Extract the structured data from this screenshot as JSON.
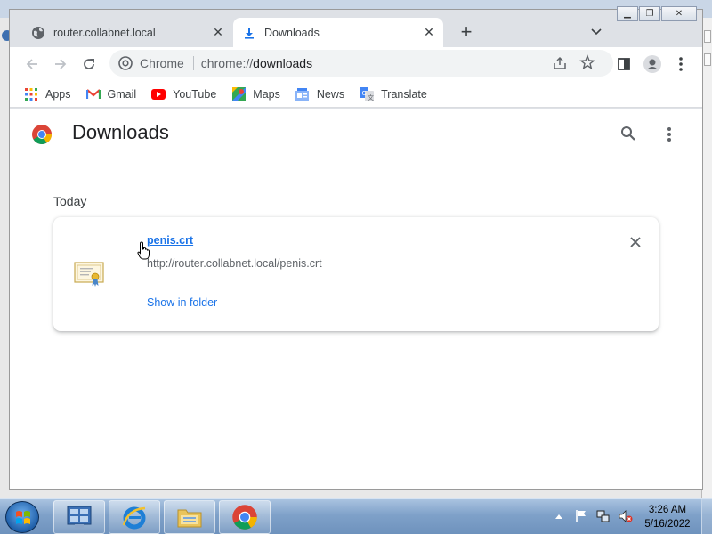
{
  "tabs": [
    {
      "title": "router.collabnet.local",
      "favicon": "globe-icon",
      "active": false
    },
    {
      "title": "Downloads",
      "favicon": "download-icon",
      "active": true
    }
  ],
  "omnibox": {
    "chip": "Chrome",
    "scheme": "chrome://",
    "host": "downloads"
  },
  "bookmarks": [
    {
      "label": "Apps",
      "icon": "apps-grid-icon"
    },
    {
      "label": "Gmail",
      "icon": "gmail-icon"
    },
    {
      "label": "YouTube",
      "icon": "youtube-icon"
    },
    {
      "label": "Maps",
      "icon": "maps-icon"
    },
    {
      "label": "News",
      "icon": "news-icon"
    },
    {
      "label": "Translate",
      "icon": "translate-icon"
    }
  ],
  "downloads_page": {
    "title": "Downloads",
    "date_label": "Today",
    "item": {
      "filename": "penis.crt",
      "url": "http://router.collabnet.local/penis.crt",
      "action": "Show in folder",
      "icon": "certificate-icon"
    }
  },
  "taskbar": {
    "time": "3:26 AM",
    "date": "5/16/2022",
    "pinned": [
      "server-manager-icon",
      "internet-explorer-icon",
      "file-explorer-icon",
      "chrome-icon"
    ]
  },
  "colors": {
    "link": "#1a73e8",
    "tab_strip": "#dee1e6",
    "taskbar": "#7fa1c9"
  }
}
